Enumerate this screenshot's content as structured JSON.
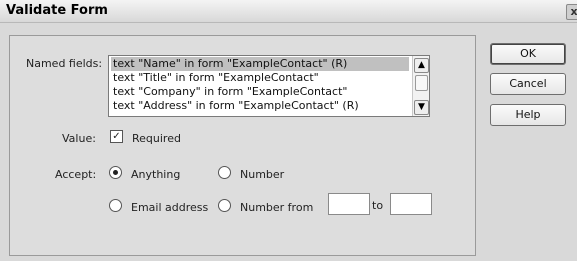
{
  "window": {
    "title": "Validate Form",
    "close_glyph": "x"
  },
  "form": {
    "named_fields_label": "Named fields:",
    "named_fields": [
      "text \"Name\" in form \"ExampleContact\" (R)",
      "text \"Title\" in form \"ExampleContact\"",
      "text \"Company\" in form \"ExampleContact\"",
      "text \"Address\" in form \"ExampleContact\" (R)"
    ],
    "selected_index": 0,
    "value_label": "Value:",
    "required_label": "Required",
    "required_checked": true,
    "accept_label": "Accept:",
    "accept_options": {
      "anything": "Anything",
      "number": "Number",
      "email": "Email address",
      "number_from": "Number from",
      "to": "to"
    },
    "accept_selected": "anything",
    "number_from_value": "",
    "number_to_value": ""
  },
  "buttons": {
    "ok": "OK",
    "cancel": "Cancel",
    "help": "Help"
  },
  "icons": {
    "check_glyph": "✓",
    "scroll_up_glyph": "▲",
    "scroll_down_glyph": "▼"
  }
}
